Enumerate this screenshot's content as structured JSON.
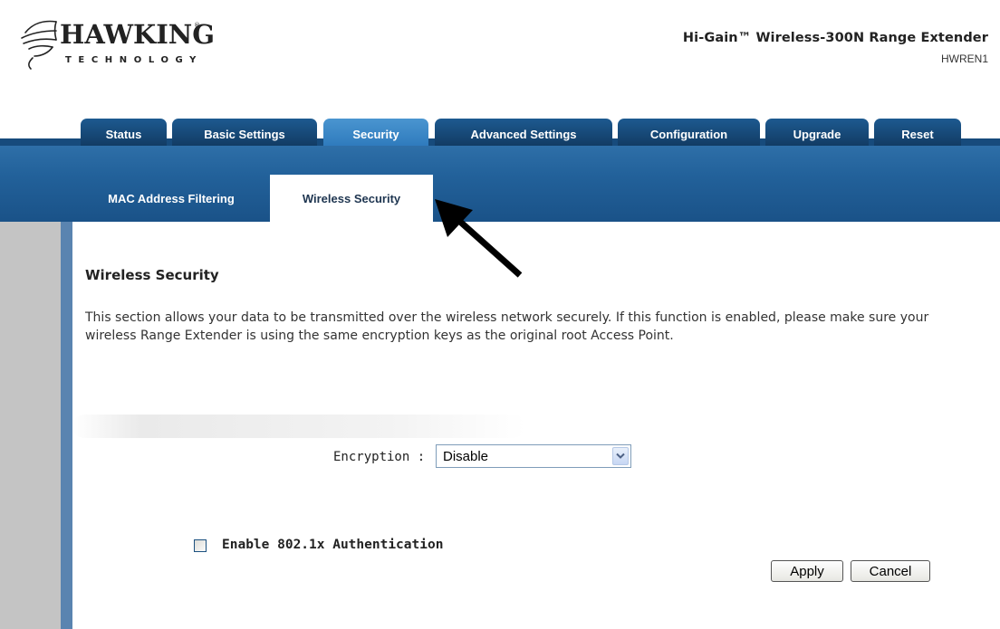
{
  "header": {
    "brand": "HAWKING",
    "brand_sub": "TECHNOLOGY",
    "product_title": "Hi-Gain™ Wireless-300N Range Extender",
    "model": "HWREN1"
  },
  "main_tabs": [
    {
      "label": "Status",
      "active": false
    },
    {
      "label": "Basic Settings",
      "active": false
    },
    {
      "label": "Security",
      "active": true
    },
    {
      "label": "Advanced Settings",
      "active": false
    },
    {
      "label": "Configuration",
      "active": false
    },
    {
      "label": "Upgrade",
      "active": false
    },
    {
      "label": "Reset",
      "active": false
    }
  ],
  "sub_tabs": [
    {
      "label": "MAC Address Filtering",
      "active": false
    },
    {
      "label": "Wireless Security",
      "active": true
    }
  ],
  "content": {
    "title": "Wireless Security",
    "description": "This section allows your data to be transmitted over the wireless network securely. If this function is enabled, please make sure your wireless Range Extender is using the same encryption keys as the original root Access Point.",
    "encryption_label": "Encryption :",
    "encryption_value": "Disable",
    "auth_label": "Enable 802.1x Authentication",
    "auth_checked": false,
    "apply_label": "Apply",
    "cancel_label": "Cancel"
  },
  "colors": {
    "tab_dark": "#174b7c",
    "tab_active": "#3c88c8",
    "sub_bar": "#22619a",
    "rail_gray": "#c4c4c4",
    "rail_blue": "#5a84b0"
  }
}
